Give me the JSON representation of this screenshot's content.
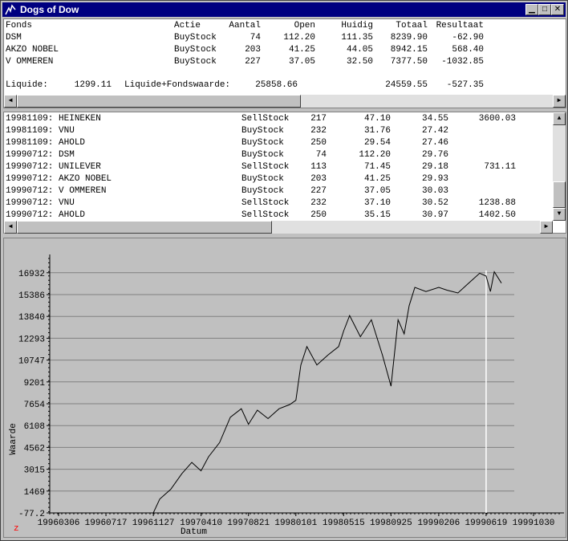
{
  "window": {
    "title": "Dogs of Dow"
  },
  "portfolio": {
    "headers": [
      "Fonds",
      "Actie",
      "Aantal",
      "Open",
      "Huidig",
      "Totaal",
      "Resultaat"
    ],
    "rows": [
      [
        "DSM",
        "BuyStock",
        "74",
        "112.20",
        "111.35",
        "8239.90",
        "-62.90"
      ],
      [
        "AKZO NOBEL",
        "BuyStock",
        "203",
        "41.25",
        "44.05",
        "8942.15",
        "568.40"
      ],
      [
        "V OMMEREN",
        "BuyStock",
        "227",
        "37.05",
        "32.50",
        "7377.50",
        "-1032.85"
      ]
    ],
    "summary": {
      "liquide_label": "Liquide:",
      "liquide_value": "1299.11",
      "fondswaarde_label": "Liquide+Fondswaarde:",
      "fondswaarde_value": "25858.66",
      "total": "24559.55",
      "result": "-527.35"
    }
  },
  "transactions": {
    "rows": [
      [
        "19981109: HEINEKEN",
        "SellStock",
        "217",
        "47.10",
        "34.55",
        "3600.03"
      ],
      [
        "19981109: VNU",
        "BuyStock",
        "232",
        "31.76",
        "27.42",
        ""
      ],
      [
        "19981109: AHOLD",
        "BuyStock",
        "250",
        "29.54",
        "27.46",
        ""
      ],
      [
        "19990712: DSM",
        "BuyStock",
        "74",
        "112.20",
        "29.76",
        ""
      ],
      [
        "19990712: UNILEVER",
        "SellStock",
        "113",
        "71.45",
        "29.18",
        "731.11"
      ],
      [
        "19990712: AKZO NOBEL",
        "BuyStock",
        "203",
        "41.25",
        "29.93",
        ""
      ],
      [
        "19990712: V OMMEREN",
        "BuyStock",
        "227",
        "37.05",
        "30.03",
        ""
      ],
      [
        "19990712: VNU",
        "SellStock",
        "232",
        "37.10",
        "30.52",
        "1238.88"
      ],
      [
        "19990712: AHOLD",
        "SellStock",
        "250",
        "35.15",
        "30.97",
        "1402.50"
      ]
    ]
  },
  "chart_data": {
    "type": "line",
    "xlabel": "Datum",
    "ylabel": "Waarde",
    "corner_label": "z",
    "y_ticks": [
      "-77.2",
      "1469",
      "3015",
      "4562",
      "6108",
      "7654",
      "9201",
      "10747",
      "12293",
      "13840",
      "15386",
      "16932"
    ],
    "y_range": [
      -77.2,
      18000
    ],
    "x_ticks": [
      "19960306",
      "19960717",
      "19961127",
      "19970410",
      "19970821",
      "19980101",
      "19980515",
      "19980925",
      "19990206",
      "19990619",
      "19991030"
    ],
    "series": [
      {
        "x": [
          "19961127",
          "19961215",
          "19970115",
          "19970215",
          "19970315",
          "19970410",
          "19970501",
          "19970601",
          "19970701",
          "19970801",
          "19970821",
          "19970915",
          "19971015",
          "19971115",
          "19971215",
          "19980101",
          "19980115",
          "19980201",
          "19980301",
          "19980401",
          "19980501",
          "19980515",
          "19980601",
          "19980701",
          "19980801",
          "19980901",
          "19980925",
          "19981015",
          "19981101",
          "19981115",
          "19981201",
          "19990101",
          "19990206",
          "19990301",
          "19990401",
          "19990501",
          "19990601",
          "19990619",
          "19990701",
          "19990712",
          "19990801"
        ],
        "y": [
          -77.2,
          900,
          1600,
          2700,
          3500,
          2900,
          3900,
          4900,
          6700,
          7300,
          6200,
          7200,
          6600,
          7300,
          7600,
          7900,
          10400,
          11700,
          10400,
          11100,
          11700,
          12800,
          13900,
          12400,
          13600,
          11100,
          8900,
          13600,
          12600,
          14600,
          15900,
          15600,
          15900,
          15700,
          15500,
          16200,
          16900,
          16700,
          15600,
          17000,
          16200
        ]
      }
    ],
    "marker_x": "19990619",
    "grid": true
  }
}
